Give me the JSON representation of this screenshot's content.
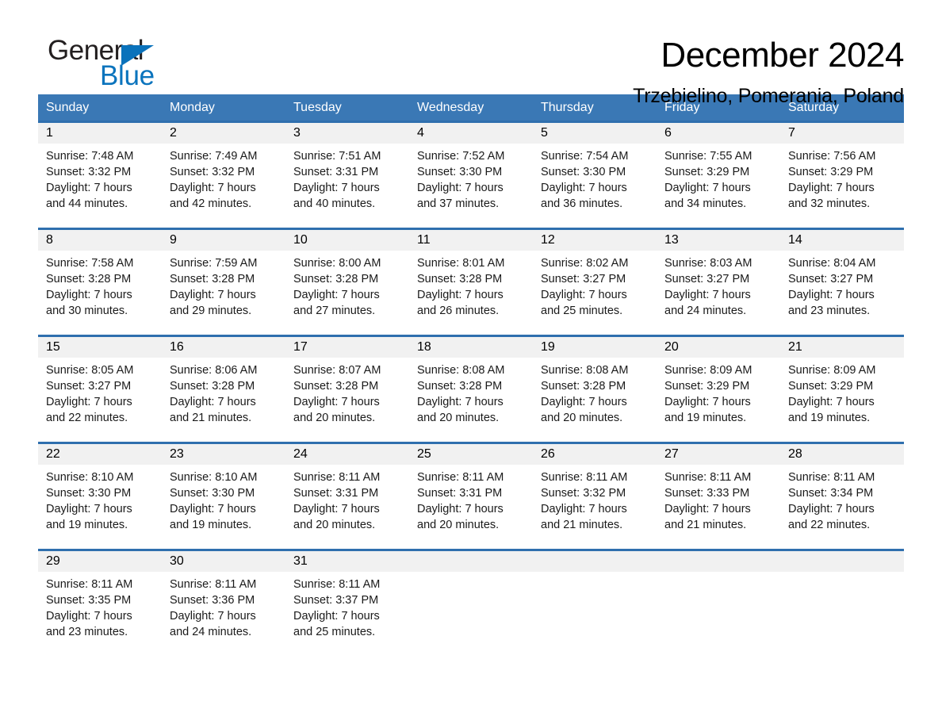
{
  "brand": {
    "name_part1": "General",
    "name_part2": "Blue",
    "accent_color": "#0b74bd",
    "triangle_icon": "triangle-icon"
  },
  "header": {
    "month_title": "December 2024",
    "location": "Trzebielino, Pomerania, Poland"
  },
  "calendar": {
    "header_bg": "#3a78b5",
    "weekday_text_color": "#ffffff",
    "week_divider_color": "#2f6fae",
    "daynum_band_color": "#f1f1f1",
    "weekdays": [
      "Sunday",
      "Monday",
      "Tuesday",
      "Wednesday",
      "Thursday",
      "Friday",
      "Saturday"
    ],
    "weeks": [
      [
        {
          "day": "1",
          "sunrise": "Sunrise: 7:48 AM",
          "sunset": "Sunset: 3:32 PM",
          "daylight_line1": "Daylight: 7 hours",
          "daylight_line2": "and 44 minutes."
        },
        {
          "day": "2",
          "sunrise": "Sunrise: 7:49 AM",
          "sunset": "Sunset: 3:32 PM",
          "daylight_line1": "Daylight: 7 hours",
          "daylight_line2": "and 42 minutes."
        },
        {
          "day": "3",
          "sunrise": "Sunrise: 7:51 AM",
          "sunset": "Sunset: 3:31 PM",
          "daylight_line1": "Daylight: 7 hours",
          "daylight_line2": "and 40 minutes."
        },
        {
          "day": "4",
          "sunrise": "Sunrise: 7:52 AM",
          "sunset": "Sunset: 3:30 PM",
          "daylight_line1": "Daylight: 7 hours",
          "daylight_line2": "and 37 minutes."
        },
        {
          "day": "5",
          "sunrise": "Sunrise: 7:54 AM",
          "sunset": "Sunset: 3:30 PM",
          "daylight_line1": "Daylight: 7 hours",
          "daylight_line2": "and 36 minutes."
        },
        {
          "day": "6",
          "sunrise": "Sunrise: 7:55 AM",
          "sunset": "Sunset: 3:29 PM",
          "daylight_line1": "Daylight: 7 hours",
          "daylight_line2": "and 34 minutes."
        },
        {
          "day": "7",
          "sunrise": "Sunrise: 7:56 AM",
          "sunset": "Sunset: 3:29 PM",
          "daylight_line1": "Daylight: 7 hours",
          "daylight_line2": "and 32 minutes."
        }
      ],
      [
        {
          "day": "8",
          "sunrise": "Sunrise: 7:58 AM",
          "sunset": "Sunset: 3:28 PM",
          "daylight_line1": "Daylight: 7 hours",
          "daylight_line2": "and 30 minutes."
        },
        {
          "day": "9",
          "sunrise": "Sunrise: 7:59 AM",
          "sunset": "Sunset: 3:28 PM",
          "daylight_line1": "Daylight: 7 hours",
          "daylight_line2": "and 29 minutes."
        },
        {
          "day": "10",
          "sunrise": "Sunrise: 8:00 AM",
          "sunset": "Sunset: 3:28 PM",
          "daylight_line1": "Daylight: 7 hours",
          "daylight_line2": "and 27 minutes."
        },
        {
          "day": "11",
          "sunrise": "Sunrise: 8:01 AM",
          "sunset": "Sunset: 3:28 PM",
          "daylight_line1": "Daylight: 7 hours",
          "daylight_line2": "and 26 minutes."
        },
        {
          "day": "12",
          "sunrise": "Sunrise: 8:02 AM",
          "sunset": "Sunset: 3:27 PM",
          "daylight_line1": "Daylight: 7 hours",
          "daylight_line2": "and 25 minutes."
        },
        {
          "day": "13",
          "sunrise": "Sunrise: 8:03 AM",
          "sunset": "Sunset: 3:27 PM",
          "daylight_line1": "Daylight: 7 hours",
          "daylight_line2": "and 24 minutes."
        },
        {
          "day": "14",
          "sunrise": "Sunrise: 8:04 AM",
          "sunset": "Sunset: 3:27 PM",
          "daylight_line1": "Daylight: 7 hours",
          "daylight_line2": "and 23 minutes."
        }
      ],
      [
        {
          "day": "15",
          "sunrise": "Sunrise: 8:05 AM",
          "sunset": "Sunset: 3:27 PM",
          "daylight_line1": "Daylight: 7 hours",
          "daylight_line2": "and 22 minutes."
        },
        {
          "day": "16",
          "sunrise": "Sunrise: 8:06 AM",
          "sunset": "Sunset: 3:28 PM",
          "daylight_line1": "Daylight: 7 hours",
          "daylight_line2": "and 21 minutes."
        },
        {
          "day": "17",
          "sunrise": "Sunrise: 8:07 AM",
          "sunset": "Sunset: 3:28 PM",
          "daylight_line1": "Daylight: 7 hours",
          "daylight_line2": "and 20 minutes."
        },
        {
          "day": "18",
          "sunrise": "Sunrise: 8:08 AM",
          "sunset": "Sunset: 3:28 PM",
          "daylight_line1": "Daylight: 7 hours",
          "daylight_line2": "and 20 minutes."
        },
        {
          "day": "19",
          "sunrise": "Sunrise: 8:08 AM",
          "sunset": "Sunset: 3:28 PM",
          "daylight_line1": "Daylight: 7 hours",
          "daylight_line2": "and 20 minutes."
        },
        {
          "day": "20",
          "sunrise": "Sunrise: 8:09 AM",
          "sunset": "Sunset: 3:29 PM",
          "daylight_line1": "Daylight: 7 hours",
          "daylight_line2": "and 19 minutes."
        },
        {
          "day": "21",
          "sunrise": "Sunrise: 8:09 AM",
          "sunset": "Sunset: 3:29 PM",
          "daylight_line1": "Daylight: 7 hours",
          "daylight_line2": "and 19 minutes."
        }
      ],
      [
        {
          "day": "22",
          "sunrise": "Sunrise: 8:10 AM",
          "sunset": "Sunset: 3:30 PM",
          "daylight_line1": "Daylight: 7 hours",
          "daylight_line2": "and 19 minutes."
        },
        {
          "day": "23",
          "sunrise": "Sunrise: 8:10 AM",
          "sunset": "Sunset: 3:30 PM",
          "daylight_line1": "Daylight: 7 hours",
          "daylight_line2": "and 19 minutes."
        },
        {
          "day": "24",
          "sunrise": "Sunrise: 8:11 AM",
          "sunset": "Sunset: 3:31 PM",
          "daylight_line1": "Daylight: 7 hours",
          "daylight_line2": "and 20 minutes."
        },
        {
          "day": "25",
          "sunrise": "Sunrise: 8:11 AM",
          "sunset": "Sunset: 3:31 PM",
          "daylight_line1": "Daylight: 7 hours",
          "daylight_line2": "and 20 minutes."
        },
        {
          "day": "26",
          "sunrise": "Sunrise: 8:11 AM",
          "sunset": "Sunset: 3:32 PM",
          "daylight_line1": "Daylight: 7 hours",
          "daylight_line2": "and 21 minutes."
        },
        {
          "day": "27",
          "sunrise": "Sunrise: 8:11 AM",
          "sunset": "Sunset: 3:33 PM",
          "daylight_line1": "Daylight: 7 hours",
          "daylight_line2": "and 21 minutes."
        },
        {
          "day": "28",
          "sunrise": "Sunrise: 8:11 AM",
          "sunset": "Sunset: 3:34 PM",
          "daylight_line1": "Daylight: 7 hours",
          "daylight_line2": "and 22 minutes."
        }
      ],
      [
        {
          "day": "29",
          "sunrise": "Sunrise: 8:11 AM",
          "sunset": "Sunset: 3:35 PM",
          "daylight_line1": "Daylight: 7 hours",
          "daylight_line2": "and 23 minutes."
        },
        {
          "day": "30",
          "sunrise": "Sunrise: 8:11 AM",
          "sunset": "Sunset: 3:36 PM",
          "daylight_line1": "Daylight: 7 hours",
          "daylight_line2": "and 24 minutes."
        },
        {
          "day": "31",
          "sunrise": "Sunrise: 8:11 AM",
          "sunset": "Sunset: 3:37 PM",
          "daylight_line1": "Daylight: 7 hours",
          "daylight_line2": "and 25 minutes."
        },
        {
          "day": "",
          "sunrise": "",
          "sunset": "",
          "daylight_line1": "",
          "daylight_line2": ""
        },
        {
          "day": "",
          "sunrise": "",
          "sunset": "",
          "daylight_line1": "",
          "daylight_line2": ""
        },
        {
          "day": "",
          "sunrise": "",
          "sunset": "",
          "daylight_line1": "",
          "daylight_line2": ""
        },
        {
          "day": "",
          "sunrise": "",
          "sunset": "",
          "daylight_line1": "",
          "daylight_line2": ""
        }
      ]
    ]
  }
}
